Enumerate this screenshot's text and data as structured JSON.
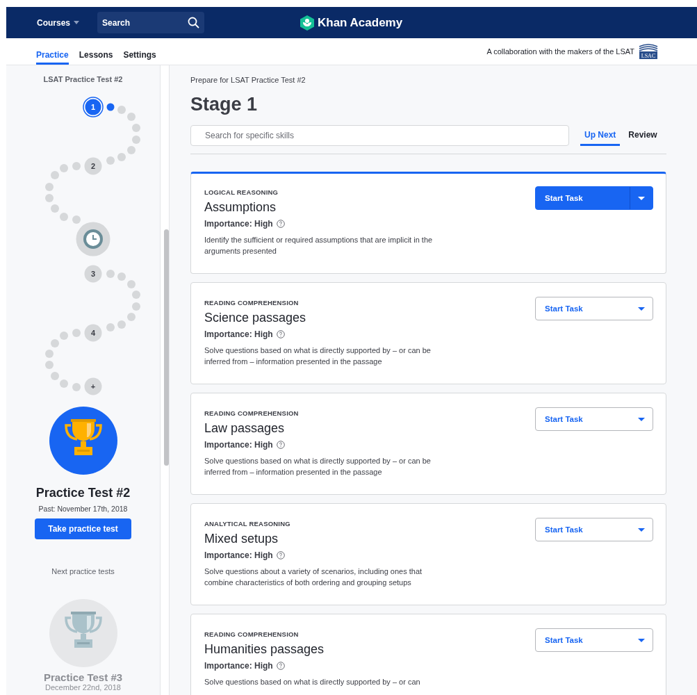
{
  "header": {
    "courses_menu": "Courses",
    "search": {
      "placeholder": "Search"
    },
    "logo_text": "Khan Academy"
  },
  "subnav": {
    "tabs": [
      {
        "label": "Practice",
        "selected": true
      },
      {
        "label": "Lessons",
        "selected": false
      },
      {
        "label": "Settings",
        "selected": false
      }
    ],
    "collaboration_note": "A collaboration with the makers of the LSAT",
    "partner_logo_text": "LSAC"
  },
  "sidebar": {
    "title": "LSAT Practice Test #2",
    "path_nodes": [
      {
        "kind": "stage",
        "label": "1",
        "selected": true
      },
      {
        "kind": "stage",
        "label": "2",
        "selected": false
      },
      {
        "kind": "timer",
        "selected": false
      },
      {
        "kind": "stage",
        "label": "3",
        "selected": false
      },
      {
        "kind": "stage",
        "label": "4",
        "selected": false
      },
      {
        "kind": "stage",
        "label": "+",
        "selected": false
      }
    ],
    "current_test": {
      "title": "Practice Test #2",
      "date": "Past: November 17th, 2018",
      "button": "Take practice test"
    },
    "next_heading": "Next practice tests",
    "next_test": {
      "title": "Practice Test #3",
      "date": "December 22nd, 2018"
    }
  },
  "main": {
    "breadcrumb": "Prepare for LSAT Practice Test #2",
    "heading": "Stage 1",
    "skill_search": {
      "placeholder": "Search for specific skills"
    },
    "view_tabs": [
      {
        "label": "Up Next",
        "selected": true
      },
      {
        "label": "Review",
        "selected": false
      }
    ],
    "tasks": [
      {
        "category": "LOGICAL REASONING",
        "title": "Assumptions",
        "importance": "Importance: High",
        "description": "Identify the sufficient or required assumptions that are implicit in the arguments presented",
        "button": "Start Task",
        "highlighted": true
      },
      {
        "category": "READING COMPREHENSION",
        "title": "Science passages",
        "importance": "Importance: High",
        "description": "Solve questions based on what is directly supported by – or can be inferred from – information presented in the passage",
        "button": "Start Task",
        "highlighted": false
      },
      {
        "category": "READING COMPREHENSION",
        "title": "Law passages",
        "importance": "Importance: High",
        "description": "Solve questions based on what is directly supported by – or can be inferred from – information presented in the passage",
        "button": "Start Task",
        "highlighted": false
      },
      {
        "category": "ANALYTICAL REASONING",
        "title": "Mixed setups",
        "importance": "Importance: High",
        "description": "Solve questions about a variety of scenarios, including ones that combine characteristics of both ordering and grouping setups",
        "button": "Start Task",
        "highlighted": false
      },
      {
        "category": "READING COMPREHENSION",
        "title": "Humanities passages",
        "importance": "Importance: High",
        "description": "Solve questions based on what is directly supported by – or can",
        "button": "Start Task",
        "highlighted": false
      }
    ]
  }
}
